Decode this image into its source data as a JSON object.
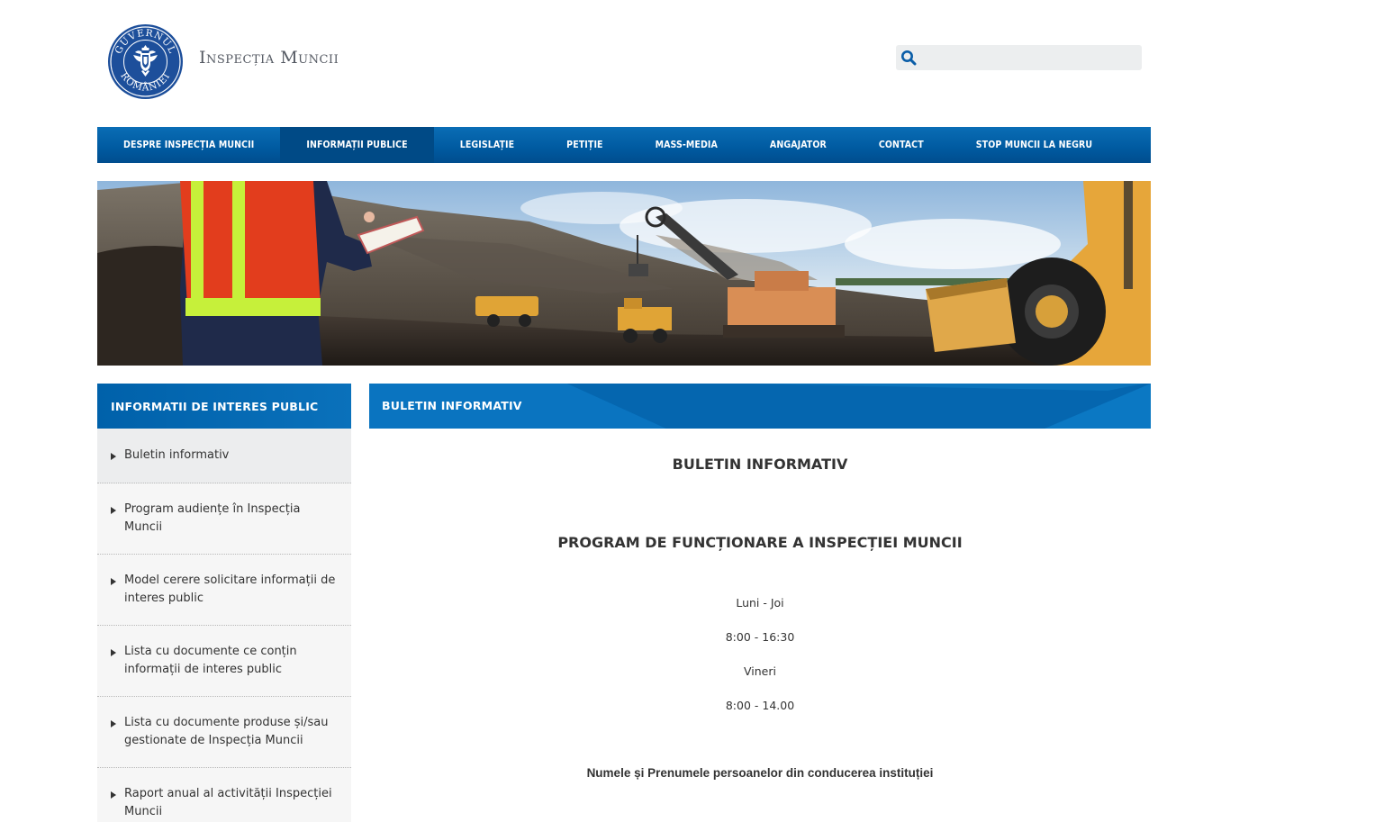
{
  "header": {
    "logo_text_top": "GUVERNUL",
    "logo_text_bottom": "ROMÂNIEI",
    "site_title": "Inspecția Muncii",
    "search_placeholder": ""
  },
  "nav": {
    "items": [
      {
        "label": "DESPRE INSPECȚIA MUNCII"
      },
      {
        "label": "INFORMAȚII PUBLICE"
      },
      {
        "label": "LEGISLAȚIE"
      },
      {
        "label": "PETIȚIE"
      },
      {
        "label": "MASS-MEDIA"
      },
      {
        "label": "ANGAJATOR"
      },
      {
        "label": "CONTACT"
      },
      {
        "label": "STOP MUNCII LA NEGRU"
      }
    ],
    "active_index": 1
  },
  "sidebar": {
    "title": "INFORMATII DE INTERES PUBLIC",
    "items": [
      {
        "label": "Buletin informativ"
      },
      {
        "label": "Program audiențe în Inspecția Muncii"
      },
      {
        "label": "Model cerere solicitare informații de interes public"
      },
      {
        "label": "Lista cu documente ce conțin informații de interes public"
      },
      {
        "label": "Lista cu documente produse și/sau gestionate de Inspecția Muncii"
      },
      {
        "label": "Raport anual al activității Inspecției Muncii"
      }
    ]
  },
  "main": {
    "section_title": "BULETIN INFORMATIV",
    "heading": "BULETIN INFORMATIV",
    "subheading": "PROGRAM DE FUNCȚIONARE A INSPECȚIEI MUNCII",
    "schedule": [
      "Luni - Joi",
      "8:00 - 16:30",
      "Vineri",
      "8:00 - 14.00"
    ],
    "leadership_label": "Numele și Prenumele persoanelor din conducerea instituției"
  },
  "colors": {
    "nav_blue": "#005aa0",
    "nav_active": "#004a86",
    "header_blue": "#0061aa",
    "logo_blue": "#1d4f9b"
  },
  "icons": {
    "search": "search-icon",
    "bullet": "triangle-right-icon"
  }
}
